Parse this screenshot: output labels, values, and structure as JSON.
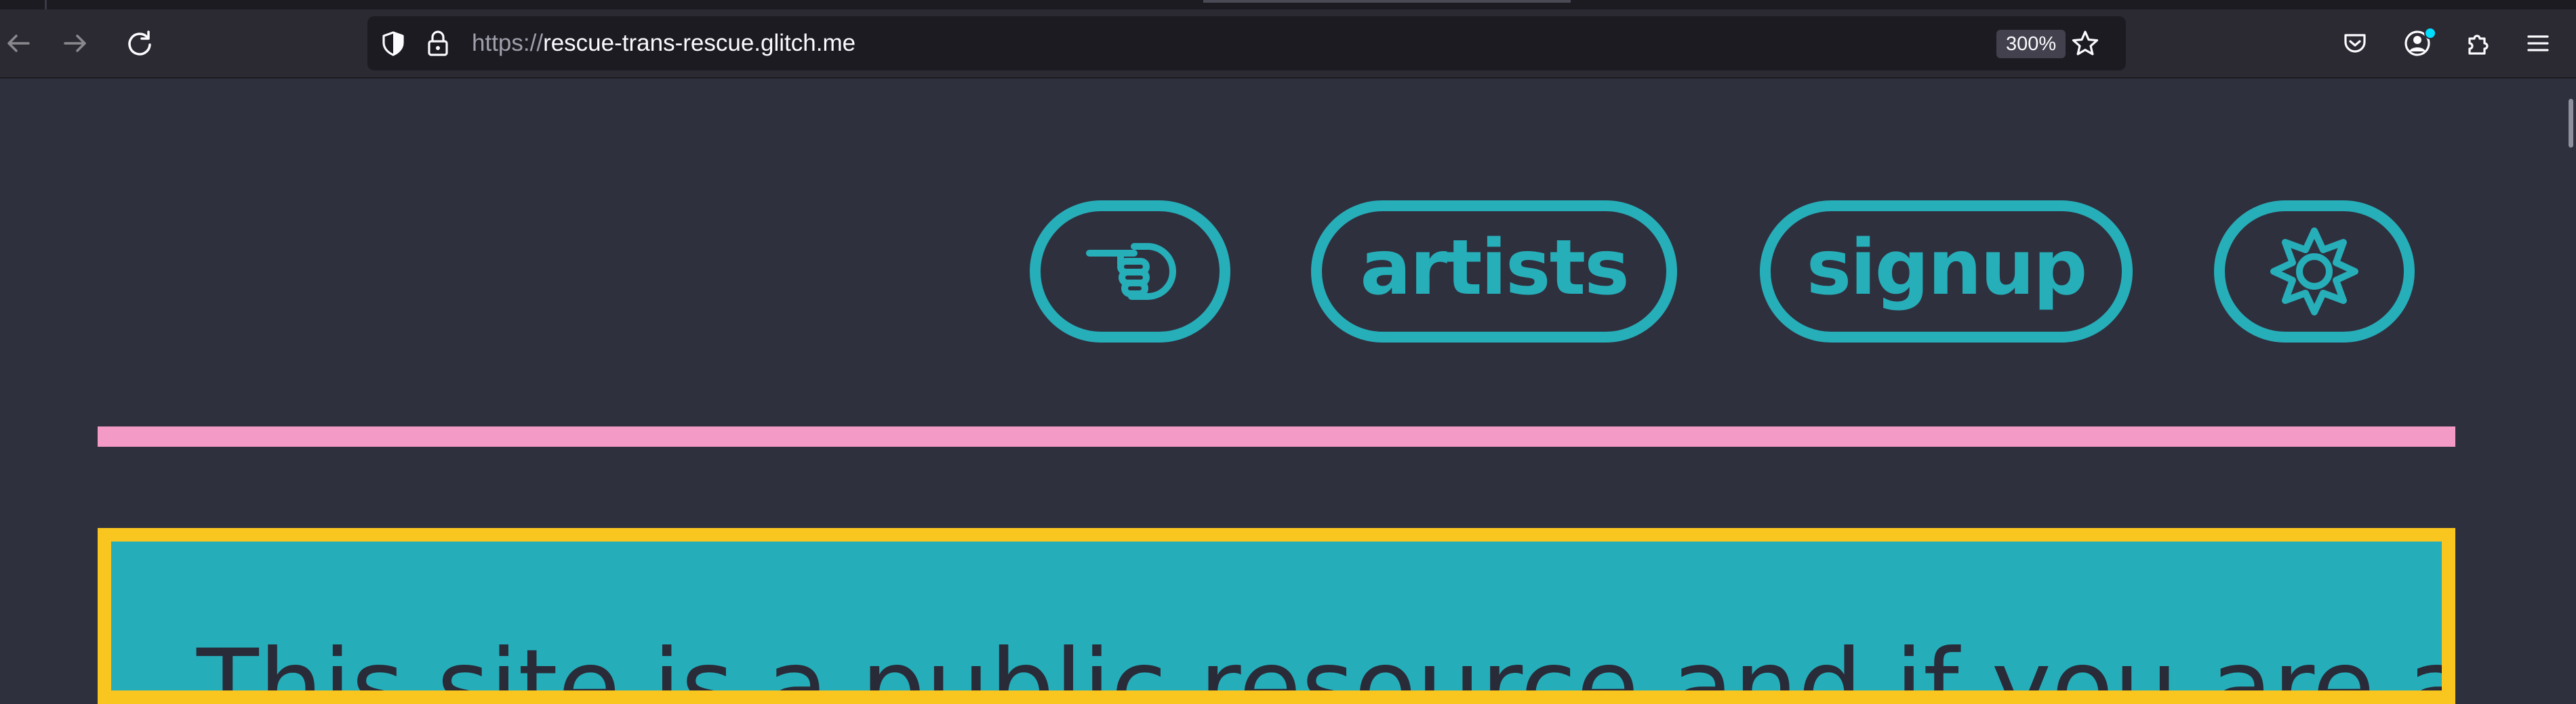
{
  "browser": {
    "url_protocol": "https://",
    "url_host": "rescue-trans-rescue.glitch.me",
    "zoom": "300%"
  },
  "nav": {
    "artists_label": "artists",
    "signup_label": "signup"
  },
  "hero": {
    "text": "This site is a public resource and if you are a trans rescue"
  },
  "colors": {
    "page_bg": "#2f303e",
    "accent_teal": "#26aeb9",
    "divider_pink": "#f39ac6",
    "hero_border_yellow": "#f9c51f"
  },
  "icons": {
    "nav_first": "pointing-hand-icon",
    "nav_last": "gear-icon"
  }
}
